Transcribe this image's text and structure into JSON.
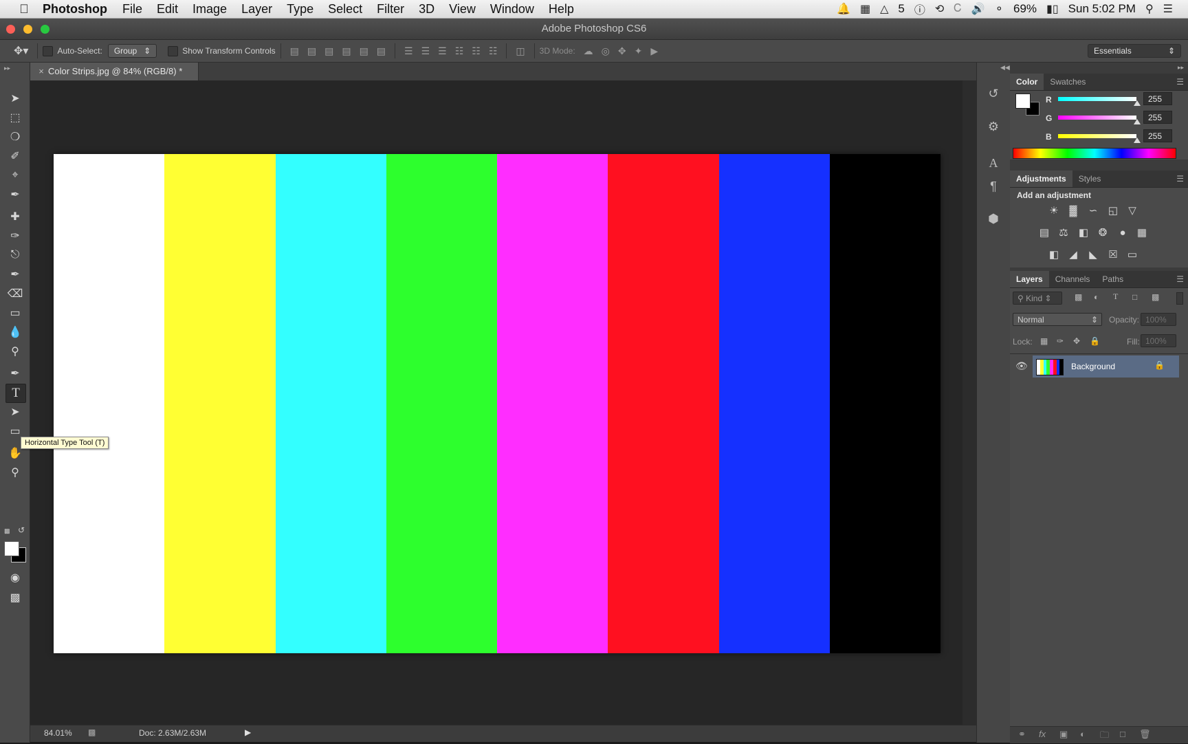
{
  "menubar": {
    "app_name": "Photoshop",
    "menus": [
      "File",
      "Edit",
      "Image",
      "Layer",
      "Type",
      "Select",
      "Filter",
      "3D",
      "View",
      "Window",
      "Help"
    ],
    "status": {
      "adobe_badge_count": "5",
      "battery_percent": "69%",
      "clock": "Sun 5:02 PM"
    }
  },
  "window": {
    "title": "Adobe Photoshop CS6"
  },
  "options_bar": {
    "auto_select_label": "Auto-Select:",
    "auto_select_value": "Group",
    "show_transform_label": "Show Transform Controls",
    "mode_3d_label": "3D Mode:",
    "workspace": "Essentials"
  },
  "document": {
    "tab_title": "Color Strips.jpg @ 84% (RGB/8) *",
    "strip_colors": [
      "#ffffff",
      "#ffff33",
      "#33ffff",
      "#2dff2d",
      "#ff2dff",
      "#ff1020",
      "#1530ff",
      "#000000"
    ]
  },
  "tooltip": "Horizontal Type Tool (T)",
  "status_bar": {
    "zoom": "84.01%",
    "doc_size": "Doc: 2.63M/2.63M"
  },
  "color_panel": {
    "tabs": [
      "Color",
      "Swatches"
    ],
    "channels": [
      {
        "label": "R",
        "value": "255",
        "color": "#28e6e6"
      },
      {
        "label": "G",
        "value": "255",
        "color": "#e628e6"
      },
      {
        "label": "B",
        "value": "255",
        "color": "#f0f028"
      }
    ]
  },
  "adjustments_panel": {
    "tabs": [
      "Adjustments",
      "Styles"
    ],
    "heading": "Add an adjustment"
  },
  "layers_panel": {
    "tabs": [
      "Layers",
      "Channels",
      "Paths"
    ],
    "filter_kind": "Kind",
    "blend_mode": "Normal",
    "opacity_label": "Opacity:",
    "opacity_value": "100%",
    "lock_label": "Lock:",
    "fill_label": "Fill:",
    "fill_value": "100%",
    "layers": [
      {
        "name": "Background"
      }
    ]
  }
}
